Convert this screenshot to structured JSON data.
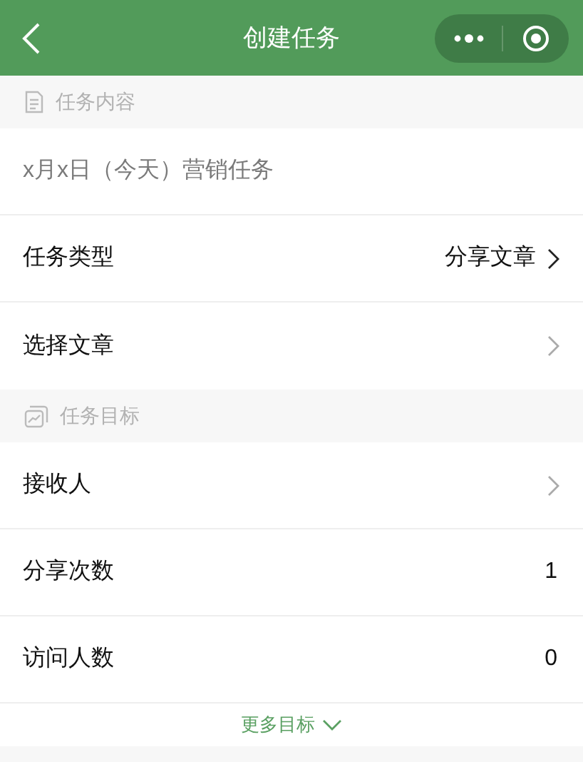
{
  "nav_bar": {
    "title": "创建任务"
  },
  "sections": [
    {
      "title": "任务内容",
      "rows": [
        {
          "kind": "text",
          "placeholder": "x月x日（今天）营销任务"
        },
        {
          "kind": "link",
          "label": "任务类型",
          "value": "分享文章"
        },
        {
          "kind": "link",
          "label": "选择文章"
        }
      ]
    },
    {
      "title": "任务目标",
      "rows": [
        {
          "kind": "link",
          "label": "接收人"
        },
        {
          "kind": "number",
          "label": "分享次数",
          "value": "1"
        },
        {
          "kind": "number",
          "label": "访问人数",
          "value": "0"
        }
      ],
      "more": {
        "label": "更多目标",
        "expanded": false
      }
    }
  ]
}
